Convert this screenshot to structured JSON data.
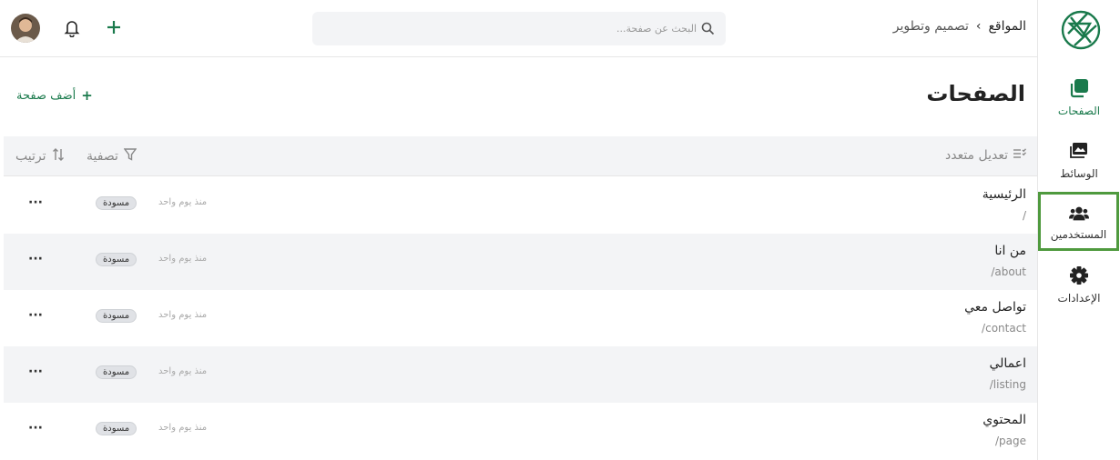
{
  "header": {
    "breadcrumb": {
      "root": "المواقع",
      "separator": "›",
      "current": "تصميم وتطوير"
    },
    "search": {
      "placeholder": "البحث عن صفحة..."
    }
  },
  "sidebar": {
    "items": [
      {
        "label": "الصفحات",
        "icon": "pages-icon",
        "active": true
      },
      {
        "label": "الوسائط",
        "icon": "media-icon",
        "active": false
      },
      {
        "label": "المستخدمين",
        "icon": "users-icon",
        "active": false,
        "highlighted": true
      },
      {
        "label": "الإعدادات",
        "icon": "settings-icon",
        "active": false
      }
    ]
  },
  "main": {
    "title": "الصفحات",
    "add_page_label": "أضف صفحة",
    "toolbar": {
      "bulk_edit_label": "تعديل متعدد",
      "filter_label": "تصفية",
      "sort_label": "ترتيب"
    },
    "rows": [
      {
        "title": "الرئيسية",
        "path": "/",
        "time": "منذ يوم واحد",
        "status": "مسودة"
      },
      {
        "title": "من انا",
        "path": "/about",
        "time": "منذ يوم واحد",
        "status": "مسودة"
      },
      {
        "title": "تواصل معي",
        "path": "/contact",
        "time": "منذ يوم واحد",
        "status": "مسودة"
      },
      {
        "title": "اعمالي",
        "path": "/listing",
        "time": "منذ يوم واحد",
        "status": "مسودة"
      },
      {
        "title": "المحتوي",
        "path": "/page",
        "time": "منذ يوم واحد",
        "status": "مسودة"
      }
    ],
    "more_label": "···"
  },
  "colors": {
    "accent": "#1a7a4c",
    "highlight_outline": "#4f9a3e",
    "toolbar_bg": "#f3f4f6",
    "badge_bg": "#e0e2e6"
  }
}
